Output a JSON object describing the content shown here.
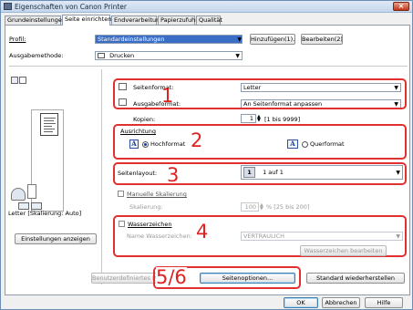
{
  "window": {
    "title": "Eigenschaften von Canon Printer",
    "close": "×"
  },
  "tabs": [
    "Grundeinstellungen",
    "Seite einrichten",
    "Endverarbeitung",
    "Papierzufuhr",
    "Qualität"
  ],
  "profile": {
    "label": "Profil:",
    "value": "Standardeinstellungen",
    "add_button": "Hinzufügen(1)...",
    "edit_button": "Bearbeiten(2)..."
  },
  "output": {
    "label": "Ausgabemethode:",
    "value": "Drucken"
  },
  "page_size": {
    "label": "Seitenformat:",
    "value": "Letter"
  },
  "output_size": {
    "label": "Ausgabeformat:",
    "value": "An Seitenformat anpassen"
  },
  "copies": {
    "label": "Kopien:",
    "value": "1",
    "range": "[1 bis 9999]"
  },
  "orientation": {
    "label": "Ausrichtung",
    "portrait": "Hochformat",
    "landscape": "Querformat",
    "glyph": "A"
  },
  "layout": {
    "label": "Seitenlayout:",
    "number": "1",
    "value": "1 auf 1"
  },
  "scaling": {
    "manual_label": "Manuelle Skalierung",
    "label": "Skalierung:",
    "value": "100",
    "range": "% [25 bis 200]"
  },
  "watermark": {
    "label": "Wasserzeichen",
    "name_label": "Name Wasserzeichen:",
    "value": "VERTRAULICH",
    "edit_button": "Wasserzeichen bearbeiten"
  },
  "preview_caption": "Letter [Skalierung: Auto]",
  "view_settings_button": "Einstellungen anzeigen",
  "user_paper_button": "Benutzerdefiniertes Papier...",
  "page_options_button": "Seitenoptionen...",
  "restore_button": "Standard wiederherstellen",
  "dialog_buttons": {
    "ok": "OK",
    "cancel": "Abbrechen",
    "help": "Hilfe"
  },
  "annotations": [
    "1",
    "2",
    "3",
    "4",
    "5/6"
  ],
  "colors": {
    "annotation_red": "#e03030",
    "selection_blue": "#3a6ec6"
  }
}
